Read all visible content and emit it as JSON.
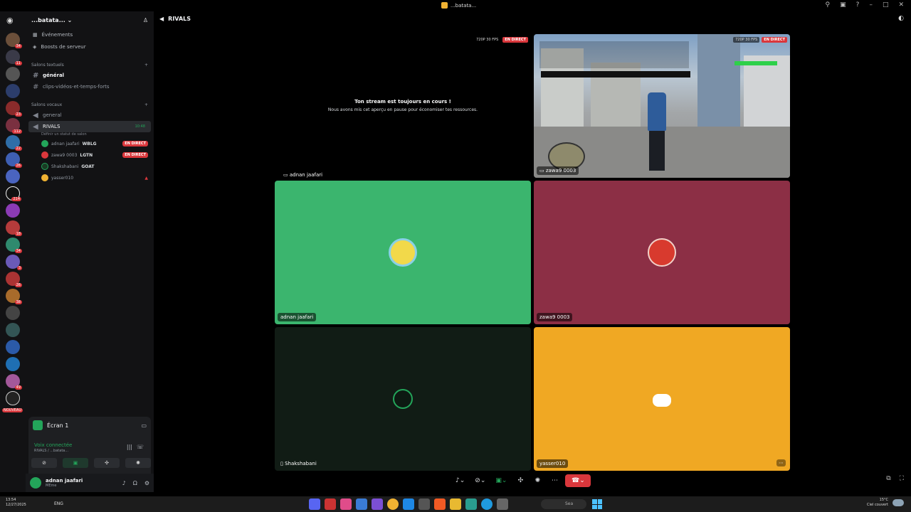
{
  "window": {
    "title": "...batata..."
  },
  "server": {
    "name": "...batata..."
  },
  "sidebar": {
    "links": [
      {
        "label": "Événements",
        "icon": "calendar-icon"
      },
      {
        "label": "Boosts de serveur",
        "icon": "boost-icon"
      }
    ],
    "text_category": "Salons textuels",
    "text_channels": [
      "général",
      "clips-vidéos-et-temps-forts"
    ],
    "voice_category": "Salons vocaux",
    "voice_channels": [
      "general",
      "RIVALS"
    ],
    "rivals_time": "10:48",
    "rivals_status": "Définir un statut de salon",
    "voice_users": [
      {
        "name": "adnan jaafari",
        "tag": "WBLG",
        "live": "EN DIRECT",
        "color": "#23a55a"
      },
      {
        "name": "zawa9 0003",
        "tag": "LGTN",
        "live": "EN DIRECT",
        "color": "#da373c"
      },
      {
        "name": "Shakshabani",
        "tag": "GOAT",
        "live": "",
        "color": "#1a3a24"
      },
      {
        "name": "yasser010",
        "tag": "",
        "live": "",
        "color": "#f0b232"
      }
    ]
  },
  "rail_badges": [
    "34",
    "11",
    "23",
    "112",
    "22",
    "26",
    "214",
    "18",
    "34",
    "3",
    "26",
    "38",
    "49",
    "NOUVEAU"
  ],
  "screen_panel": {
    "label": "Écran 1"
  },
  "voice_connected": {
    "title": "Voix connectée",
    "subtitle": "RIVALS / ...batata..."
  },
  "user": {
    "name": "adnan jaafari",
    "status": "MEme"
  },
  "call": {
    "channel": "RIVALS",
    "paused_title": "Ton stream est toujours en cours !",
    "paused_sub": "Nous avons mis cet aperçu en pause pour économiser tes ressources.",
    "fps_badge": "720P 30 FPS",
    "live_badge": "EN DIRECT",
    "tiles": [
      {
        "name": "adnan jaafari",
        "color": "#3bb56e"
      },
      {
        "name": "zawa9 0003",
        "color": "#8c2f45"
      },
      {
        "name": "Shakshabani",
        "color": "#111c15"
      },
      {
        "name": "yasser010",
        "color": "#f0a823"
      }
    ],
    "stream_names": [
      "adnan jaafari",
      "zawa9 0003"
    ]
  },
  "taskbar": {
    "time": "13:54",
    "date": "12/27/2025",
    "lang": "ENG",
    "temp": "15°C",
    "weather": "Ciel couvert",
    "search": "Sea"
  }
}
